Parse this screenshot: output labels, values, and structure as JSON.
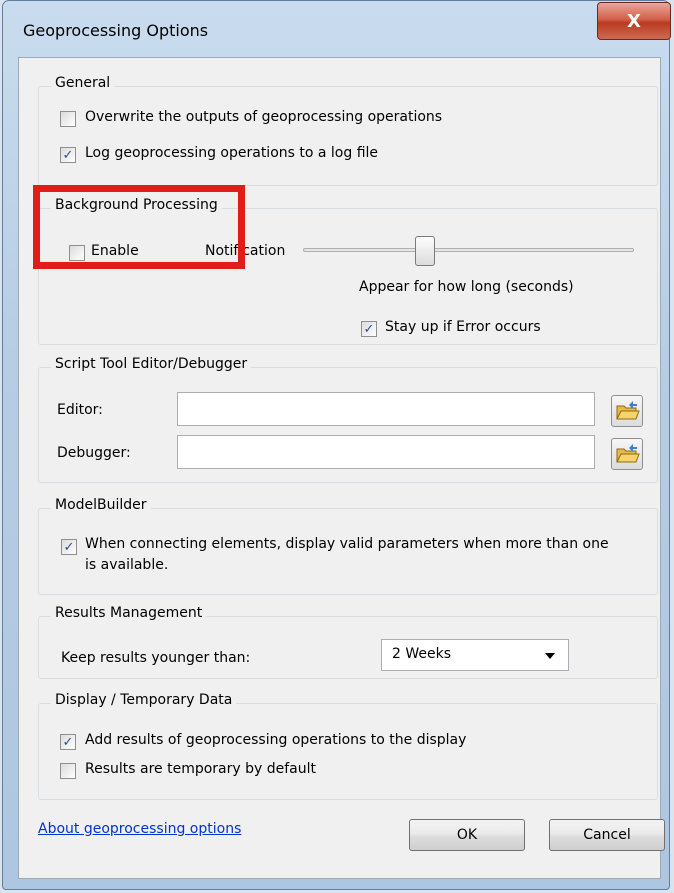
{
  "window": {
    "title": "Geoprocessing Options",
    "close_glyph": "X"
  },
  "general": {
    "title": "General",
    "overwrite": {
      "label": "Overwrite the outputs of geoprocessing operations",
      "checked": false
    },
    "log": {
      "label": "Log geoprocessing operations to a log file",
      "checked": true
    }
  },
  "background": {
    "title": "Background Processing",
    "enable": {
      "label": "Enable",
      "checked": false
    },
    "notification_label": "Notification",
    "slider_caption": "Appear for how long (seconds)",
    "slider_fraction": 0.37,
    "stay_up": {
      "label": "Stay up if Error occurs",
      "checked": true
    }
  },
  "script_tool": {
    "title": "Script Tool Editor/Debugger",
    "editor_label": "Editor:",
    "editor_value": "",
    "debugger_label": "Debugger:",
    "debugger_value": ""
  },
  "modelbuilder": {
    "title": "ModelBuilder",
    "option": {
      "label_line1": "When connecting elements, display valid parameters when more than one",
      "label_line2": "is available.",
      "checked": true
    }
  },
  "results": {
    "title": "Results Management",
    "keep_label": "Keep results younger than:",
    "keep_value": "2 Weeks"
  },
  "display": {
    "title": "Display / Temporary Data",
    "add_results": {
      "label": "Add results of geoprocessing operations to the display",
      "checked": true
    },
    "temporary": {
      "label": "Results are temporary by default",
      "checked": false
    }
  },
  "footer": {
    "help_link": "About geoprocessing options",
    "ok_label": "OK",
    "cancel_label": "Cancel"
  },
  "colors": {
    "highlight_box": "#e21b1b",
    "link": "#0033cc"
  },
  "icons": {
    "folder": "open-folder-icon",
    "dropdown": "chevron-down-icon",
    "check": "checkmark-icon"
  }
}
